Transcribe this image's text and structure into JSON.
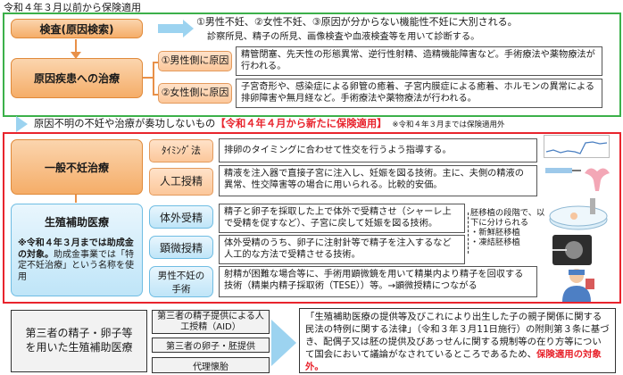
{
  "top_note": "令和４年３月以前から保険適用",
  "exam": {
    "label": "検査(原因検索)",
    "desc": "①男性不妊、②女性不妊、③原因が分からない機能性不妊に大別される。",
    "sub": "診察所見、精子の所見、画像検査や血液検査等を用いて診断する。"
  },
  "cause_treatment": {
    "label": "原因疾患への治療",
    "male_label": "①男性側に原因",
    "male_text": "精管閉塞、先天性の形態異常、逆行性射精、造精機能障害など。手術療法や薬物療法が行われる。",
    "female_label": "②女性側に原因",
    "female_text": "子宮奇形や、感染症による卵管の癒着、子宮内膜症による癒着、ホルモンの異常による排卵障害や無月経など。手術療法や薬物療法が行われる。"
  },
  "mid_banner": {
    "text": "原因不明の不妊や治療が奏功しないもの",
    "red": "【令和４年４月から新たに保険適用】",
    "note": "※令和４年３月までは保険適用外"
  },
  "general": {
    "label": "一般不妊治療",
    "timing_label": "ﾀｲﾐﾝｸﾞ法",
    "timing_text": "排卵のタイミングに合わせて性交を行うよう指導する。",
    "ai_label": "人工授精",
    "ai_text": "精液を注入器で直接子宮に注入し、妊娠を図る技術。主に、夫側の精液の異常、性交障害等の場合に用いられる。比較的安価。"
  },
  "art": {
    "label": "生殖補助医療",
    "note_bold": "※令和４年３月までは助成金の対象。",
    "note_rest": "助成金事業では「特定不妊治療」という名称を使用",
    "ivf_label": "体外受精",
    "ivf_text": "精子と卵子を採取した上で体外で受精させ（シャーレ上で受精を促すなど）、子宮に戻して妊娠を図る技術。",
    "icsi_label": "顕微授精",
    "icsi_text": "体外受精のうち、卵子に注射針等で精子を注入するなど人工的な方法で受精させる技術。",
    "male_label": "男性不妊の手術",
    "male_text": "射精が困難な場合等に、手術用顕微鏡を用いて精巣内より精子を回収する技術（精巣内精子採取術（TESE））等。→顕微授精につながる",
    "embryo_title": "胚移植の段階で、以下に分けられる",
    "embryo_items": [
      "・新鮮胚移植",
      "・凍結胚移植"
    ]
  },
  "third_party": {
    "label": "第三者の精子・卵子等を用いた生殖補助医療",
    "items": [
      "第三者の精子提供による人工授精（AID）",
      "第三者の卵子・胚提供",
      "代理懐胎"
    ],
    "desc": "「生殖補助医療の提供等及びこれにより出生した子の親子関係に関する民法の特例に関する法律」（令和３年３月11日施行）の附則第３条に基づき、配偶子又は胚の提供及びあっせんに関する規制等の在り方等について国会において議論がなされているところであるため、",
    "desc_red": "保険適用の対象外。"
  }
}
